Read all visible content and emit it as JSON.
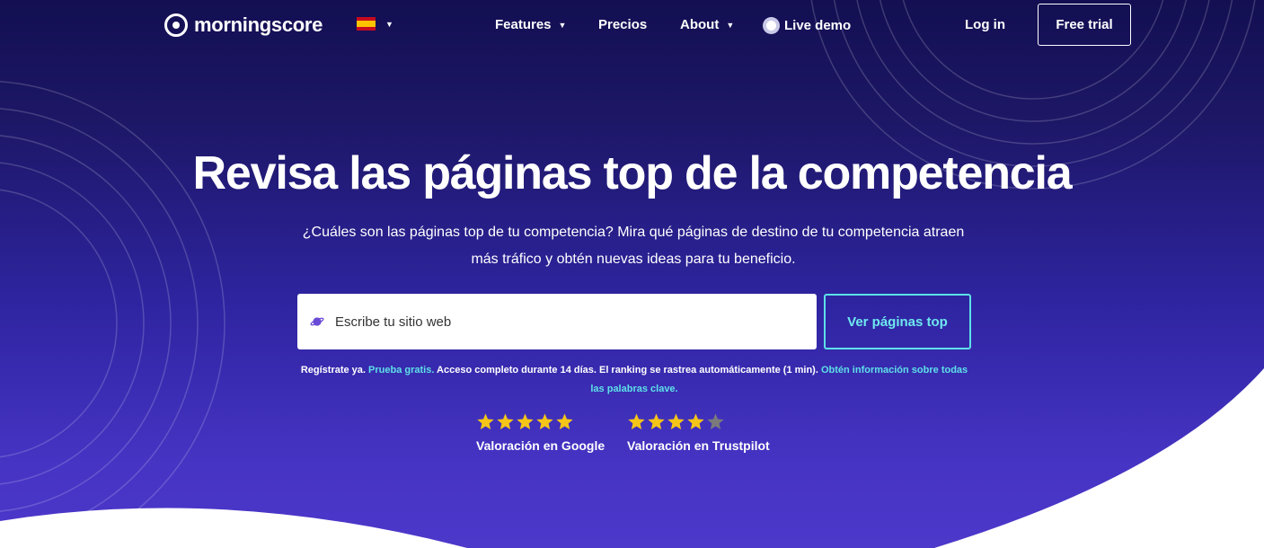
{
  "nav": {
    "logo_text": "morningscore",
    "language_flag": "spain-flag",
    "links": [
      {
        "label": "Features"
      },
      {
        "label": "Precios"
      },
      {
        "label": "About"
      },
      {
        "label": "Live demo"
      }
    ],
    "login": "Log in",
    "free_trial": "Free trial"
  },
  "hero": {
    "headline": "Revisa las páginas top de la competencia",
    "subtitle": "¿Cuáles son las páginas top de tu competencia? Mira qué páginas de destino de tu competencia atraen más tráfico y obtén nuevas ideas para tu beneficio.",
    "search": {
      "placeholder": "Escribe tu sitio web",
      "icon": "planet-icon"
    },
    "cta": "Ver páginas top",
    "fineprint": {
      "part1": "Regístrate ya. ",
      "link1": "Prueba gratis.",
      "part2": " Acceso completo durante 14 días. El ranking se rastrea automáticamente (1 min). ",
      "link2": "Obtén información sobre todas las palabras clave."
    }
  },
  "ratings": [
    {
      "label": "Valoración en Google",
      "stars": 5,
      "max": 5
    },
    {
      "label": "Valoración en Trustpilot",
      "stars": 4,
      "max": 5
    }
  ],
  "colors": {
    "accent": "#5ee0e8",
    "star": "#f5c518",
    "star_empty": "#7a7a7a",
    "background_top": "#130f52",
    "background_bottom": "#4c38ca"
  }
}
